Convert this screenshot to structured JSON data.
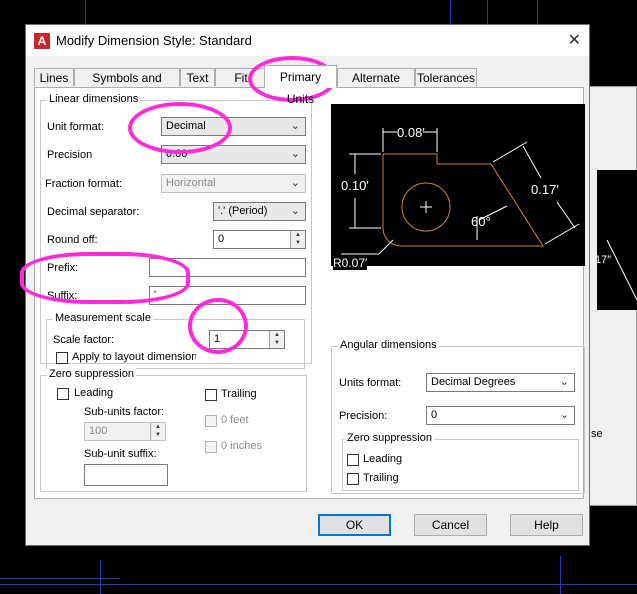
{
  "dialog": {
    "title": "Modify Dimension Style: Standard",
    "close_glyph": "✕",
    "icon_letter": "A"
  },
  "tabs": [
    "Lines",
    "Symbols and Arrows",
    "Text",
    "Fit",
    "Primary Units",
    "Alternate Units",
    "Tolerances"
  ],
  "active_tab": "Primary Units",
  "linear": {
    "title": "Linear dimensions",
    "unit_format_label": "Unit format:",
    "unit_format_value": "Decimal",
    "precision_label": "Precision",
    "precision_value": "0.00",
    "fraction_format_label": "Fraction format:",
    "fraction_format_value": "Horizontal",
    "decimal_sep_label": "Decimal separator:",
    "decimal_sep_value": "'.' (Period)",
    "round_off_label": "Round off:",
    "round_off_value": "0",
    "prefix_label": "Prefix:",
    "prefix_value": "",
    "suffix_label": "Suffix:",
    "suffix_value": "'"
  },
  "measurement": {
    "title": "Measurement scale",
    "scale_factor_label": "Scale factor:",
    "scale_factor_value": "1",
    "apply_layout_label": "Apply to layout dimensions only"
  },
  "zero_suppression": {
    "title": "Zero suppression",
    "leading_label": "Leading",
    "trailing_label": "Trailing",
    "sub_units_factor_label": "Sub-units factor:",
    "sub_units_factor_value": "100",
    "zero_feet_label": "0 feet",
    "zero_inches_label": "0 inches",
    "sub_unit_suffix_label": "Sub-unit suffix:",
    "sub_unit_suffix_value": ""
  },
  "preview": {
    "dim_top": "0.08′",
    "dim_left": "0.10′",
    "dim_right": "0.17′",
    "dim_angle": "60°",
    "dim_radius": "R0.07′",
    "colors": {
      "outline": "#c8872a",
      "dims": "#ffffff",
      "background": "#000000"
    }
  },
  "angular": {
    "title": "Angular dimensions",
    "units_format_label": "Units format:",
    "units_format_value": "Decimal Degrees",
    "precision_label": "Precision:",
    "precision_value": "0",
    "zero_title": "Zero suppression",
    "leading_label": "Leading",
    "trailing_label": "Trailing"
  },
  "buttons": {
    "ok": "OK",
    "cancel": "Cancel",
    "help": "Help"
  },
  "background_window": {
    "dim_fragment": "17″",
    "button_fragment": "se"
  },
  "annotation_color": "#ff2bdb"
}
